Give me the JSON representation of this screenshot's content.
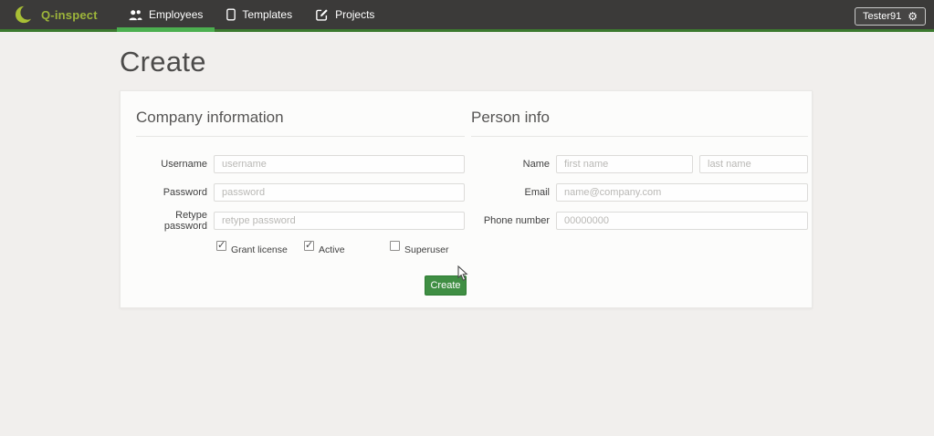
{
  "navbar": {
    "brand": "Q-inspect",
    "items": [
      {
        "label": "Employees",
        "icon": "users-icon",
        "active": true
      },
      {
        "label": "Templates",
        "icon": "tablet-icon",
        "active": false
      },
      {
        "label": "Projects",
        "icon": "edit-icon",
        "active": false
      }
    ],
    "user": {
      "label": "Tester91",
      "icon": "gear-icon"
    }
  },
  "page": {
    "title": "Create"
  },
  "company": {
    "title": "Company information",
    "rows": [
      {
        "label": "Username",
        "placeholder": "username"
      },
      {
        "label": "Password",
        "placeholder": "password"
      },
      {
        "label": "Retype password",
        "placeholder": "retype password"
      }
    ],
    "checkboxes": [
      {
        "label": "Grant license",
        "checked": true
      },
      {
        "label": "Active",
        "checked": true
      },
      {
        "label": "Superuser",
        "checked": false
      }
    ],
    "submit": "Create"
  },
  "person": {
    "title": "Person info",
    "name": {
      "label": "Name",
      "first_placeholder": "first name",
      "last_placeholder": "last name"
    },
    "email": {
      "label": "Email",
      "placeholder": "name@company.com"
    },
    "phone": {
      "label": "Phone number",
      "placeholder": "00000000"
    }
  },
  "colors": {
    "navbar_bg": "#3b3a39",
    "navbar_bottom_border": "#3c7a2f",
    "active_tab_underline": "#4caf50",
    "brand_text": "#9db53a",
    "create_button": "#3f8e43",
    "page_bg": "#f1efed",
    "card_bg": "#fcfcfb"
  }
}
